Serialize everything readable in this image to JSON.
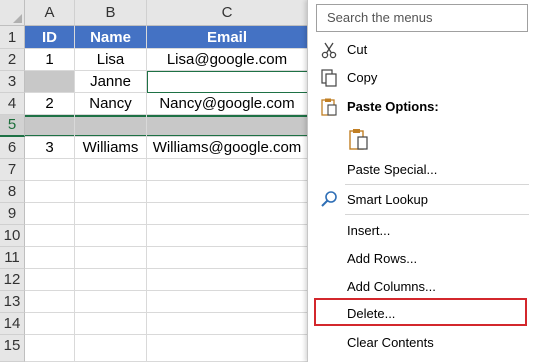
{
  "sheet": {
    "col_headers": [
      "A",
      "B",
      "C"
    ],
    "row_numbers": [
      "1",
      "2",
      "3",
      "4",
      "5",
      "6",
      "7",
      "8",
      "9",
      "10",
      "11",
      "12",
      "13",
      "14",
      "15"
    ],
    "header_row": [
      "ID",
      "Name",
      "Email"
    ],
    "rows": [
      [
        "1",
        "Lisa",
        "Lisa@google.com"
      ],
      [
        "",
        "Janne",
        ""
      ],
      [
        "2",
        "Nancy",
        "Nancy@google.com"
      ],
      [
        "",
        "",
        ""
      ],
      [
        "3",
        "Williams",
        "Williams@google.com"
      ]
    ]
  },
  "context_menu": {
    "search_placeholder": "Search the menus",
    "items": {
      "cut": "Cut",
      "copy": "Copy",
      "paste_options": "Paste Options:",
      "paste_special": "Paste Special...",
      "smart_lookup": "Smart Lookup",
      "insert": "Insert...",
      "add_rows": "Add Rows...",
      "add_columns": "Add Columns...",
      "delete": "Delete...",
      "clear_contents": "Clear Contents"
    },
    "highlight_color": "#d3272c"
  },
  "colors": {
    "header_fill": "#4472c4",
    "selected_fill": "#c8c8c8",
    "excel_green": "#1e7145"
  }
}
